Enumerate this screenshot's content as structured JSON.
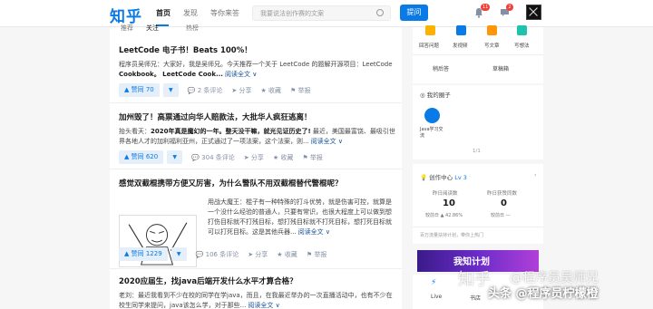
{
  "header": {
    "logo": "知乎",
    "nav": [
      "首页",
      "发现",
      "等你来答"
    ],
    "search_placeholder": "我要说法创作赛的文案",
    "ask_label": "提问",
    "notif_count": "11",
    "msg_count": "2"
  },
  "tabs": [
    "推荐",
    "关注",
    "热榜"
  ],
  "cards": [
    {
      "title": "LeetCode 电子书！Beats 100%！",
      "body_1": "程序员吴师兄：大家好，我是吴师兄。今天推荐一个关于 LeetCode 的题解开源项目：LeetCode",
      "body_2": "Cookbook。 LeetCode Cook...",
      "readmore": "阅读全文 ∨",
      "vote": "▲ 赞同 70",
      "comments": "2 条评论",
      "share": "分享",
      "collect": "收藏",
      "report": "举报"
    },
    {
      "title": "加州毁了！高票通过向华人赔款法，大批华人疯狂逃离！",
      "body_1": "抬头看天：",
      "body_1b": "2020年真是魔幻的一年。整天没干嘛，就光见证历史了!",
      "body_1c": " 最近，美国最富饶、最吸引世",
      "body_2": "界各地人才的加利福利亚州，正式通过了一项法案，这个法案，则...",
      "readmore": "阅读全文 ∨",
      "vote": "▲ 赞同 620",
      "comments": "304 条评论",
      "share": "分享",
      "collect": "收藏",
      "report": "举报"
    },
    {
      "title": "感觉双截棍携带方便又厉害，为什么警队不用双截棍替代警棍呢？",
      "body_1": "用战大魔王：棍子有一种特殊的打斗优势，就是伤害可控，就算是",
      "body_2": "一个没什么经验的普通人，只要有常识，也很大程度上可以做到想",
      "body_3": "打伤目标就不打残目标，想打残目标就不打死目标，想打死目标就",
      "body_4": "可以打死目标。这是其他兵器...",
      "readmore": "阅读全文 ∨",
      "vote": "▲ 赞同 1229",
      "comments": "106 条评论",
      "share": "分享",
      "collect": "收藏",
      "report": "举报"
    },
    {
      "title": "2020应届生，找java后端开发什么水平才算合格？",
      "body_1": "老刘：最近我看到不少在校的同学在学java，而且，在我最近举办的一次直播活动中，也有不少在",
      "body_2": "校生同学来提问，java该怎么学，对于那些...",
      "readmore": "阅读全文 ∨"
    }
  ],
  "sidebar": {
    "quick": [
      "回答问题",
      "发视频",
      "写文章",
      "写想法"
    ],
    "draft": "稍后答",
    "drafts_box": "草稿箱",
    "circle_title": "我的圈子",
    "circle_name": "Java学习交流",
    "page": "1/1",
    "creator_title": "创作中心",
    "level": "Lv 3",
    "reads_label": "昨日阅读数",
    "reads_value": "10",
    "reads_sub": "较前日 ▲ 42.86%",
    "likes_label": "昨日获赞同数",
    "likes_value": "0",
    "likes_sub": "较前日 —",
    "tip": "百万流量扶持计划，带你上热门",
    "banner_text": "我知计划",
    "live": "Live",
    "bookstore": "书店"
  },
  "watermarks": {
    "zhihu": "知乎",
    "author": "@程序员吴师兄",
    "toutiao": "头条 @程序员柠檬橙"
  }
}
